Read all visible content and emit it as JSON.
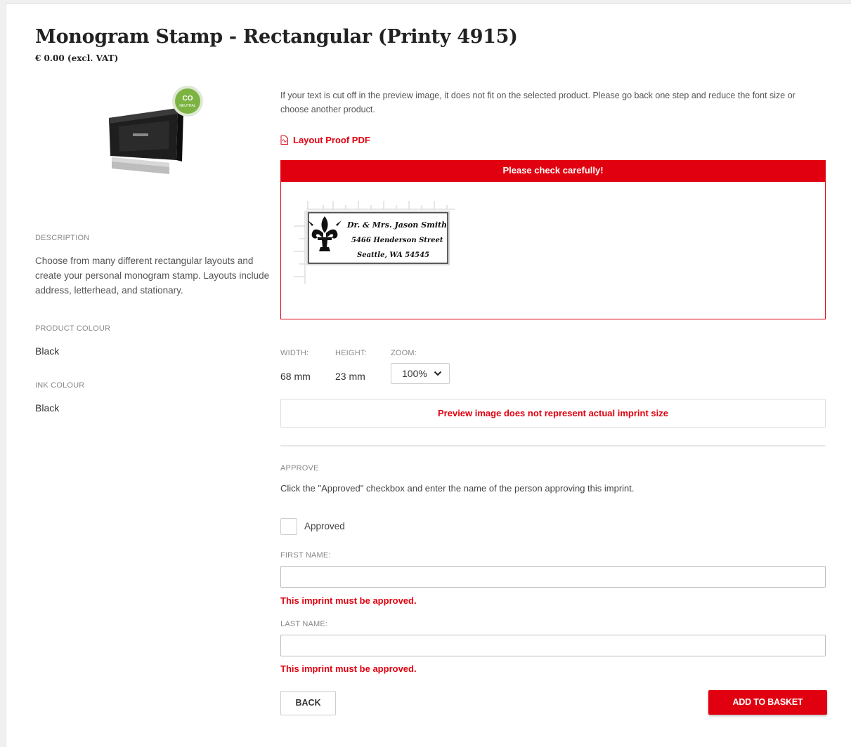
{
  "product": {
    "title": "Monogram Stamp - Rectangular (Printy 4915)",
    "price": "€ 0.00 (excl. VAT)",
    "badge_text": "CO2 NEUTRAL"
  },
  "sidebar": {
    "description_label": "DESCRIPTION",
    "description_text": "Choose from many different rectangular layouts and create your personal monogram stamp. Layouts include address, letterhead, and stationary.",
    "product_colour_label": "PRODUCT COLOUR",
    "product_colour_value": "Black",
    "ink_colour_label": "INK COLOUR",
    "ink_colour_value": "Black"
  },
  "preview": {
    "info_text": "If your text is cut off in the preview image, it does not fit on the selected product. Please go back one step and reduce the font size or choose another product.",
    "pdf_link": "Layout Proof PDF",
    "check_header": "Please check carefully!",
    "stamp_lines": [
      "Dr. & Mrs. Jason Smith",
      "5466 Henderson Street",
      "Seattle, WA 54545"
    ],
    "width_label": "WIDTH:",
    "height_label": "HEIGHT:",
    "zoom_label": "ZOOM:",
    "width_value": "68 mm",
    "height_value": "23 mm",
    "zoom_value": "100%",
    "notice": "Preview image does not represent actual imprint size"
  },
  "approve": {
    "section_label": "APPROVE",
    "instruction": "Click the \"Approved\" checkbox and enter the name of the person approving this imprint.",
    "checkbox_label": "Approved",
    "first_name_label": "FIRST NAME:",
    "first_name_value": "",
    "last_name_label": "LAST NAME:",
    "last_name_value": "",
    "error_first": "This imprint must be approved.",
    "error_last": "This imprint must be approved."
  },
  "actions": {
    "back_label": "BACK",
    "add_label": "ADD TO BASKET"
  },
  "colors": {
    "accent": "#e0000f",
    "badge_green": "#7cb342"
  }
}
